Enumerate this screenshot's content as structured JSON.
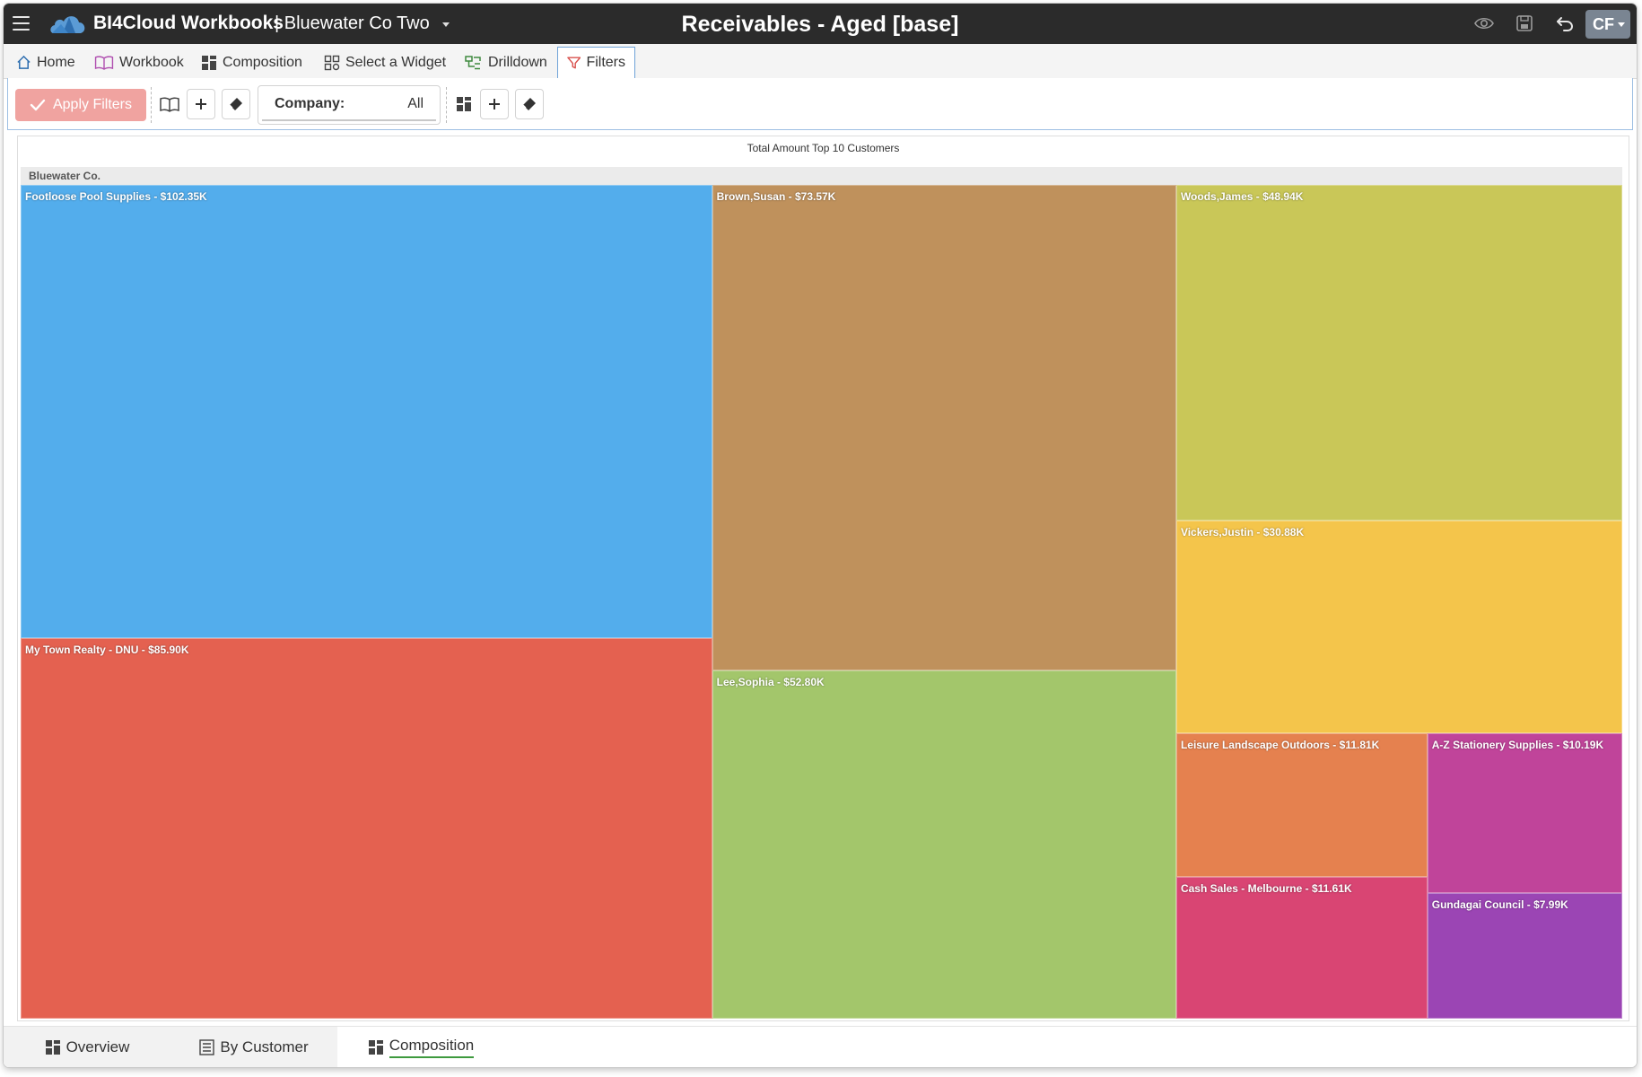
{
  "header": {
    "brand": "BI4Cloud Workbooks",
    "org": "| Bluewater Co Two",
    "title": "Receivables - Aged [base]",
    "avatar": "CF",
    "icons": [
      "menu-icon",
      "preview-eye-icon",
      "save-icon",
      "undo-icon"
    ]
  },
  "tabs": [
    {
      "label": "Home",
      "icon": "home-icon"
    },
    {
      "label": "Workbook",
      "icon": "book-icon"
    },
    {
      "label": "Composition",
      "icon": "grid-icon"
    },
    {
      "label": "Select a Widget",
      "icon": "widget-icon"
    },
    {
      "label": "Drilldown",
      "icon": "drilldown-icon"
    },
    {
      "label": "Filters",
      "icon": "filter-icon",
      "active": true
    }
  ],
  "toolbar": {
    "apply_label": "Apply Filters",
    "company_label": "Company:",
    "company_value": "All"
  },
  "widget": {
    "title": "Total Amount Top 10 Customers",
    "group": "Bluewater Co."
  },
  "chart_data": {
    "type": "treemap",
    "title": "Total Amount Top 10 Customers",
    "group": "Bluewater Co.",
    "items": [
      {
        "name": "Footloose Pool Supplies",
        "value": 102.35,
        "label": "Footloose Pool Supplies - $102.35K",
        "color": "#53adec"
      },
      {
        "name": "My Town Realty - DNU",
        "value": 85.9,
        "label": "My Town Realty - DNU - $85.90K",
        "color": "#e46150"
      },
      {
        "name": "Brown,Susan",
        "value": 73.57,
        "label": "Brown,Susan - $73.57K",
        "color": "#bf915c"
      },
      {
        "name": "Lee,Sophia",
        "value": 52.8,
        "label": "Lee,Sophia - $52.80K",
        "color": "#a3c66b"
      },
      {
        "name": "Woods,James",
        "value": 48.94,
        "label": "Woods,James - $48.94K",
        "color": "#c9c758"
      },
      {
        "name": "Vickers,Justin",
        "value": 30.88,
        "label": "Vickers,Justin - $30.88K",
        "color": "#f4c54b"
      },
      {
        "name": "Leisure Landscape Outdoors",
        "value": 11.81,
        "label": "Leisure Landscape Outdoors - $11.81K",
        "color": "#e5814f"
      },
      {
        "name": "Cash Sales - Melbourne",
        "value": 11.61,
        "label": "Cash Sales - Melbourne - $11.61K",
        "color": "#d94573"
      },
      {
        "name": "A-Z Stationery Supplies",
        "value": 10.19,
        "label": "A-Z Stationery Supplies - $10.19K",
        "color": "#c0449a"
      },
      {
        "name": "Gundagai Council",
        "value": 7.99,
        "label": "Gundagai Council - $7.99K",
        "color": "#9b45b4"
      }
    ],
    "unit": "$K"
  },
  "bottom_tabs": [
    {
      "label": "Overview",
      "icon": "grid-icon"
    },
    {
      "label": "By Customer",
      "icon": "list-icon"
    },
    {
      "label": "Composition",
      "icon": "grid-icon",
      "active": true
    }
  ]
}
